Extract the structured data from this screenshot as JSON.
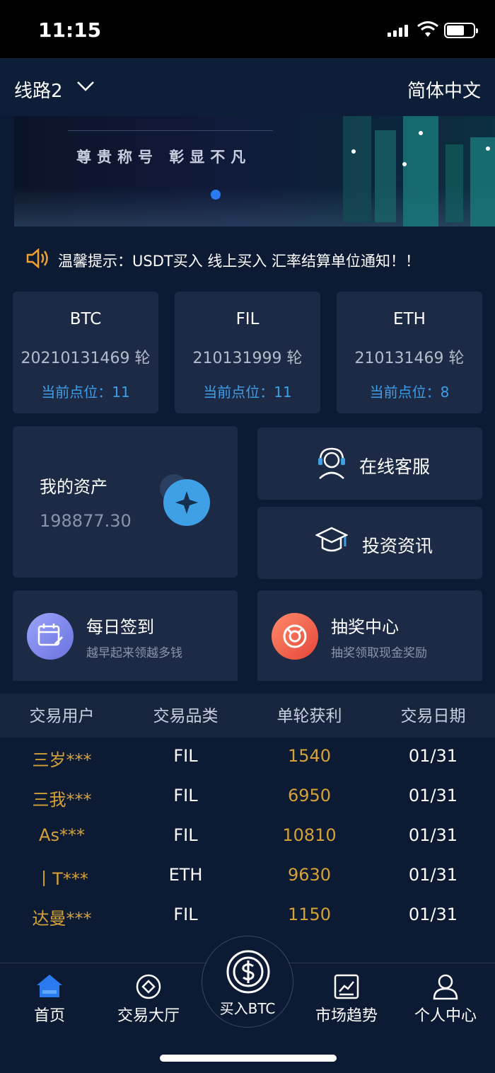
{
  "status_bar": {
    "time": "11:15"
  },
  "header": {
    "route": "线路2",
    "language": "简体中文"
  },
  "banner": {
    "slogan": "尊贵称号 彰显不凡"
  },
  "notice": {
    "text": "温馨提示：USDT买入 线上买入 汇率结算单位通知！！"
  },
  "coins": [
    {
      "name": "BTC",
      "round": "20210131469 轮",
      "point": "当前点位：11"
    },
    {
      "name": "FIL",
      "round": "210131999 轮",
      "point": "当前点位：11"
    },
    {
      "name": "ETH",
      "round": "210131469 轮",
      "point": "当前点位：8"
    }
  ],
  "assets": {
    "title": "我的资产",
    "value": "198877.30"
  },
  "side_buttons": {
    "service": "在线客服",
    "news": "投资资讯"
  },
  "features": {
    "checkin": {
      "title": "每日签到",
      "subtitle": "越早起来领越多钱"
    },
    "lottery": {
      "title": "抽奖中心",
      "subtitle": "抽奖领取现金奖励"
    }
  },
  "table": {
    "headers": [
      "交易用户",
      "交易品类",
      "单轮获利",
      "交易日期"
    ],
    "rows": [
      {
        "user": "三岁***",
        "category": "FIL",
        "profit": "1540",
        "date": "01/31"
      },
      {
        "user": "三我***",
        "category": "FIL",
        "profit": "6950",
        "date": "01/31"
      },
      {
        "user": "As***",
        "category": "FIL",
        "profit": "10810",
        "date": "01/31"
      },
      {
        "user": "丨T***",
        "category": "ETH",
        "profit": "9630",
        "date": "01/31"
      },
      {
        "user": "达曼***",
        "category": "FIL",
        "profit": "1150",
        "date": "01/31"
      }
    ]
  },
  "tabbar": {
    "home": "首页",
    "trade_hall": "交易大厅",
    "buy": "买入BTC",
    "market": "市场趋势",
    "profile": "个人中心"
  },
  "colors": {
    "background": "#0d1a33",
    "card": "#1c2a45",
    "accent_blue": "#3f9ee8",
    "gold": "#d4a238",
    "active_tab": "#2b7bf0"
  }
}
